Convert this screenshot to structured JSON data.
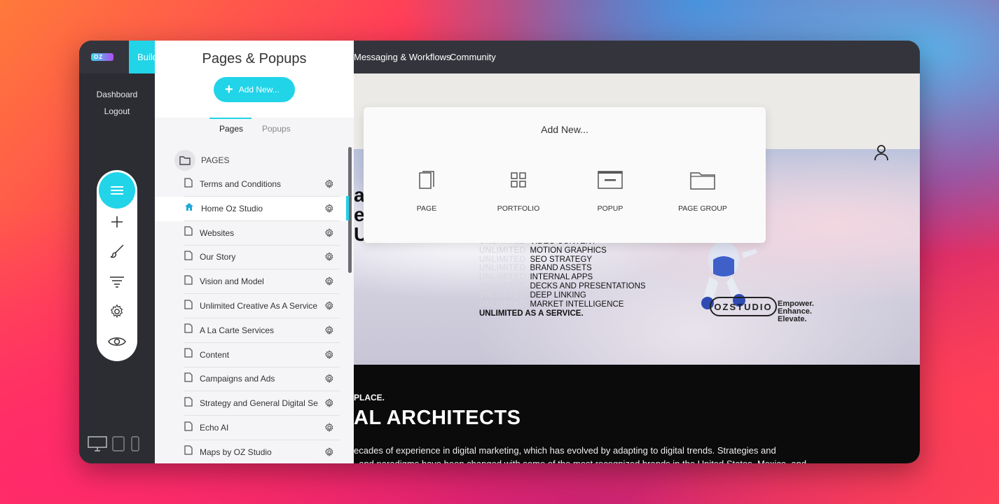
{
  "topbar": {
    "logo_text": "OZ",
    "build_tab": "Build",
    "nav": [
      "Messaging & Workflows",
      "Community"
    ]
  },
  "leftrail": {
    "links": [
      "Dashboard",
      "Logout"
    ],
    "tools": [
      "menu-icon",
      "plus-icon",
      "brush-icon",
      "filter-icon",
      "gear-icon",
      "eye-icon"
    ],
    "devices": [
      "desktop-icon",
      "tablet-icon",
      "mobile-icon"
    ]
  },
  "panel": {
    "title": "Pages & Popups",
    "add_new_label": "Add New...",
    "tabs": [
      "Pages",
      "Popups"
    ],
    "active_tab": "Pages",
    "section_label": "PAGES",
    "pages": [
      "Terms and Conditions",
      "Home Oz Studio",
      "Websites",
      "Our Story",
      "Vision and Model",
      "Unlimited Creative As A Service",
      "A La Carte Services",
      "Content",
      "Campaigns and Ads",
      "Strategy and General Digital Se...",
      "Echo AI",
      "Maps by OZ Studio"
    ],
    "home_page": "Home Oz Studio"
  },
  "popover": {
    "title": "Add New...",
    "options": [
      "PAGE",
      "PORTFOLIO",
      "POPUP",
      "PAGE GROUP"
    ]
  },
  "hero": {
    "ghost_word": "UNLIMITED",
    "services": [
      "VIDEO CONTENT",
      "MOTION GRAPHICS",
      "SEO STRATEGY",
      "BRAND ASSETS",
      "INTERNAL APPS",
      "DECKS AND PRESENTATIONS",
      "DEEP LINKING",
      "MARKET INTELLIGENCE"
    ],
    "final_line": "UNLIMITED AS A SERVICE.",
    "brand_logo": "OZSTUDIO",
    "tagline": [
      "Empower.",
      "Enhance.",
      "Elevate."
    ],
    "partial_letters": [
      "at",
      "e",
      "U"
    ]
  },
  "dark_section": {
    "eyebrow": "PLACE.",
    "heading": "AL ARCHITECTS",
    "body_line1": "ecades of experience in digital marketing, which has evolved by adapting to digital trends. Strategies and",
    "body_line2": ", and paradigms have been changed with some of the most recognized brands in the United States, Mexico, and"
  },
  "colors": {
    "accent": "#21d4e8",
    "topbar": "#34353c",
    "rail": "#2b2d33"
  }
}
